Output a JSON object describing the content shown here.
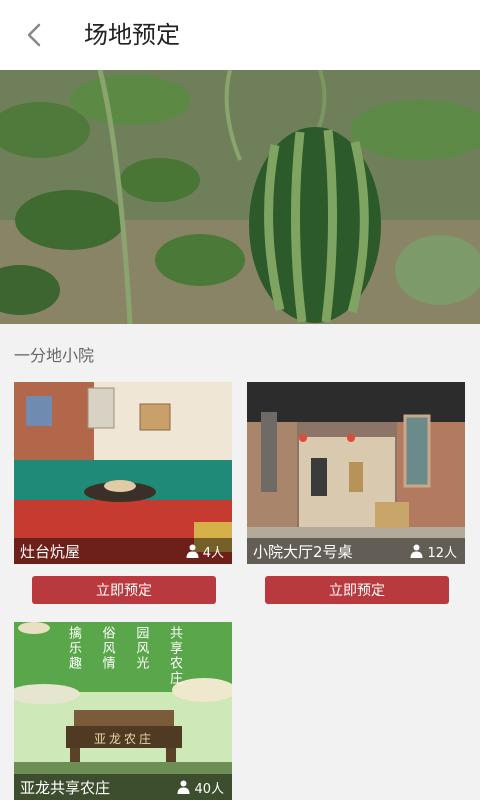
{
  "header": {
    "title": "场地预定"
  },
  "section": {
    "title": "一分地小院"
  },
  "venues": [
    {
      "name": "灶台炕屋",
      "capacity": "4人",
      "button": "立即预定"
    },
    {
      "name": "小院大厅2号桌",
      "capacity": "12人",
      "button": "立即预定"
    },
    {
      "name": "亚龙共享农庄",
      "capacity": "40人",
      "poster_columns": [
        "擒乐趣",
        "俗风情",
        "园风光",
        "共享农庄"
      ],
      "sign_text": "亚龙农庄"
    }
  ],
  "colors": {
    "accent": "#b83a3e",
    "header_bg": "#ffffff",
    "page_bg": "#f2f2f2"
  }
}
